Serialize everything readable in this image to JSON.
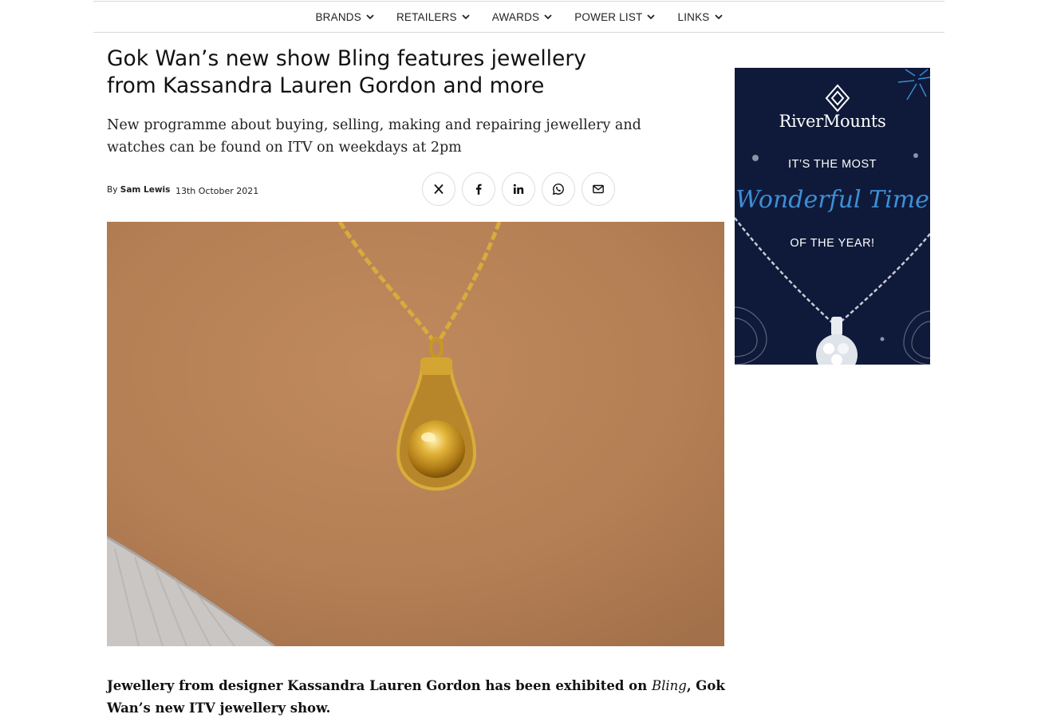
{
  "nav": {
    "items": [
      {
        "label": "BRANDS"
      },
      {
        "label": "RETAILERS"
      },
      {
        "label": "AWARDS"
      },
      {
        "label": "POWER LIST"
      },
      {
        "label": "LINKS"
      }
    ]
  },
  "article": {
    "headline": "Gok Wan’s new show Bling features jewellery from Kassandra Lauren Gordon and more",
    "standfirst": "New programme about buying, selling, making and repairing jewellery and watches can be found on ITV on weekdays at 2pm",
    "byline_prefix": "By",
    "author": "Sam Lewis",
    "date": "13th October 2021",
    "body_before": "Jewellery from designer Kassandra Lauren Gordon has been exhibited on ",
    "body_italic": "Bling",
    "body_after": ", Gok Wan’s new ITV jewellery show."
  },
  "share": {
    "icons": [
      "x-icon",
      "facebook-icon",
      "linkedin-icon",
      "whatsapp-icon",
      "email-icon"
    ]
  },
  "ad": {
    "brand": "RiverMounts",
    "line1": "IT’S THE MOST",
    "line2": "Wonderful Time",
    "line3": "OF THE YEAR!",
    "colors": {
      "background": "#0f1a3a",
      "script": "#3d8fd6"
    }
  }
}
